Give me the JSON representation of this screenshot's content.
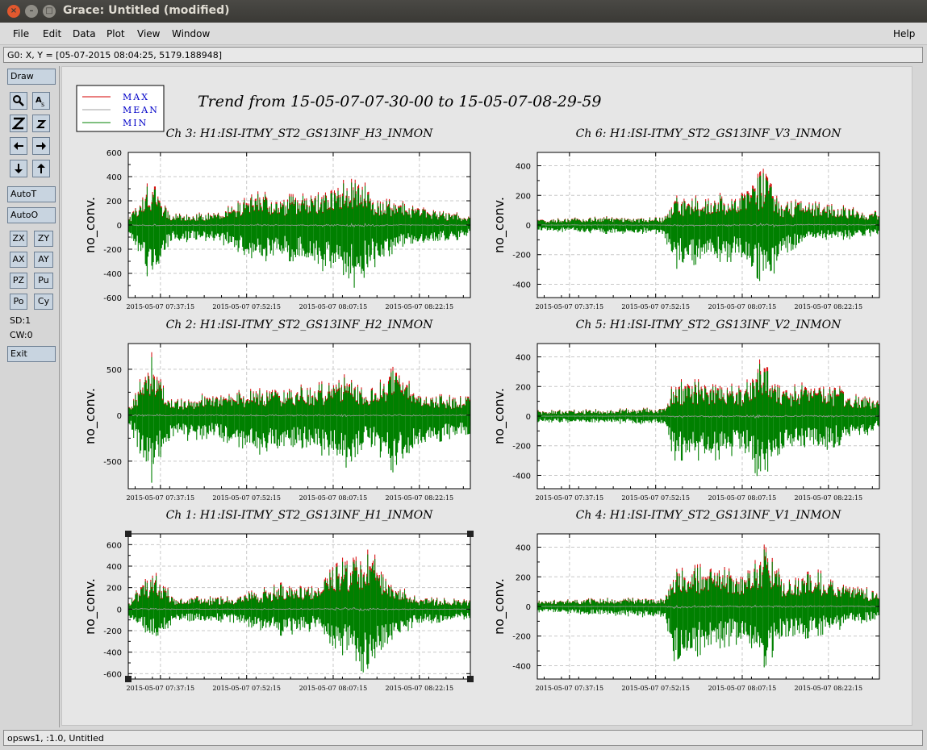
{
  "window": {
    "title": "Grace: Untitled (modified)",
    "close_glyph": "×",
    "min_glyph": "–",
    "max_glyph": "□"
  },
  "menu": {
    "items": [
      "File",
      "Edit",
      "Data",
      "Plot",
      "View",
      "Window"
    ],
    "help": "Help"
  },
  "locator": "G0: X, Y = [05-07-2015 08:04:25, 5179.188948]",
  "sidebar": {
    "draw": "Draw",
    "icon_buttons": [
      "zoom-icon",
      "autoscale-text-icon",
      "zoom-z-icon",
      "small-z-icon",
      "arrow-left-icon",
      "arrow-right-icon",
      "arrow-down-icon",
      "arrow-up-icon"
    ],
    "autot": "AutoT",
    "autoo": "AutoO",
    "pairs": [
      [
        "ZX",
        "ZY"
      ],
      [
        "AX",
        "AY"
      ],
      [
        "PZ",
        "Pu"
      ],
      [
        "Po",
        "Cy"
      ]
    ],
    "sd": "SD:1",
    "cw": "CW:0",
    "exit": "Exit"
  },
  "status": "opsws1, :1.0, Untitled",
  "legend": [
    {
      "label": "MAX",
      "color": "#d40000"
    },
    {
      "label": "MEAN",
      "color": "#a0a0a0"
    },
    {
      "label": "MIN",
      "color": "#008000"
    }
  ],
  "label_color": "#0000c8",
  "main_title": "Trend from 15-05-07-07-30-00 to 15-05-07-08-29-59",
  "chart_data": [
    {
      "type": "line",
      "title": "Ch 3: H1:ISI-ITMY_ST2_GS13INF_H3_INMON",
      "ylabel": "no_conv.",
      "ylim": [
        -600,
        600
      ],
      "yticks": [
        600,
        400,
        200,
        0,
        -200,
        -400,
        -600
      ],
      "xticks": [
        "2015-05-07 07:37:15",
        "2015-05-07 07:52:15",
        "2015-05-07 08:07:15",
        "2015-05-07 08:22:15"
      ],
      "envelope": [
        {
          "t": 0.0,
          "max": 60,
          "min": -60
        },
        {
          "t": 0.07,
          "max": 420,
          "min": -520
        },
        {
          "t": 0.12,
          "max": 110,
          "min": -150
        },
        {
          "t": 0.25,
          "max": 100,
          "min": -130
        },
        {
          "t": 0.38,
          "max": 280,
          "min": -300
        },
        {
          "t": 0.5,
          "max": 250,
          "min": -300
        },
        {
          "t": 0.6,
          "max": 360,
          "min": -420
        },
        {
          "t": 0.66,
          "max": 490,
          "min": -520
        },
        {
          "t": 0.72,
          "max": 230,
          "min": -350
        },
        {
          "t": 0.8,
          "max": 200,
          "min": -180
        },
        {
          "t": 0.92,
          "max": 130,
          "min": -150
        },
        {
          "t": 1.0,
          "max": 80,
          "min": -100
        }
      ]
    },
    {
      "type": "line",
      "title": "Ch 6: H1:ISI-ITMY_ST2_GS13INF_V3_INMON",
      "ylabel": "no_conv.",
      "ylim": [
        -490,
        490
      ],
      "yticks": [
        400,
        200,
        0,
        -200,
        -400
      ],
      "xticks": [
        "2015-05-07 07:37:15",
        "2015-05-07 07:52:15",
        "2015-05-07 08:07:15",
        "2015-05-07 08:22:15"
      ],
      "envelope": [
        {
          "t": 0.0,
          "max": 40,
          "min": -40
        },
        {
          "t": 0.2,
          "max": 60,
          "min": -60
        },
        {
          "t": 0.37,
          "max": 50,
          "min": -60
        },
        {
          "t": 0.4,
          "max": 200,
          "min": -300
        },
        {
          "t": 0.5,
          "max": 200,
          "min": -250
        },
        {
          "t": 0.6,
          "max": 250,
          "min": -250
        },
        {
          "t": 0.67,
          "max": 400,
          "min": -430
        },
        {
          "t": 0.72,
          "max": 150,
          "min": -200
        },
        {
          "t": 0.8,
          "max": 200,
          "min": -100
        },
        {
          "t": 0.9,
          "max": 130,
          "min": -100
        },
        {
          "t": 1.0,
          "max": 90,
          "min": -70
        }
      ]
    },
    {
      "type": "line",
      "title": "Ch 2: H1:ISI-ITMY_ST2_GS13INF_H2_INMON",
      "ylabel": "no_conv.",
      "ylim": [
        -800,
        780
      ],
      "yticks": [
        500,
        0,
        -500
      ],
      "xticks": [
        "2015-05-07 07:37:15",
        "2015-05-07 07:52:15",
        "2015-05-07 08:07:15",
        "2015-05-07 08:22:15"
      ],
      "envelope": [
        {
          "t": 0.0,
          "max": 100,
          "min": -100
        },
        {
          "t": 0.07,
          "max": 700,
          "min": -750
        },
        {
          "t": 0.12,
          "max": 200,
          "min": -300
        },
        {
          "t": 0.25,
          "max": 250,
          "min": -250
        },
        {
          "t": 0.4,
          "max": 300,
          "min": -450
        },
        {
          "t": 0.55,
          "max": 350,
          "min": -400
        },
        {
          "t": 0.63,
          "max": 450,
          "min": -600
        },
        {
          "t": 0.7,
          "max": 250,
          "min": -300
        },
        {
          "t": 0.78,
          "max": 550,
          "min": -650
        },
        {
          "t": 0.85,
          "max": 250,
          "min": -350
        },
        {
          "t": 1.0,
          "max": 200,
          "min": -200
        }
      ]
    },
    {
      "type": "line",
      "title": "Ch 5: H1:ISI-ITMY_ST2_GS13INF_V2_INMON",
      "ylabel": "no_conv.",
      "ylim": [
        -490,
        490
      ],
      "yticks": [
        400,
        200,
        0,
        -200,
        -400
      ],
      "xticks": [
        "2015-05-07 07:37:15",
        "2015-05-07 07:52:15",
        "2015-05-07 08:07:15",
        "2015-05-07 08:22:15"
      ],
      "envelope": [
        {
          "t": 0.0,
          "max": 40,
          "min": -40
        },
        {
          "t": 0.2,
          "max": 50,
          "min": -50
        },
        {
          "t": 0.37,
          "max": 60,
          "min": -60
        },
        {
          "t": 0.4,
          "max": 250,
          "min": -300
        },
        {
          "t": 0.52,
          "max": 250,
          "min": -300
        },
        {
          "t": 0.6,
          "max": 200,
          "min": -250
        },
        {
          "t": 0.66,
          "max": 420,
          "min": -470
        },
        {
          "t": 0.72,
          "max": 200,
          "min": -250
        },
        {
          "t": 0.82,
          "max": 250,
          "min": -250
        },
        {
          "t": 1.0,
          "max": 120,
          "min": -100
        }
      ]
    },
    {
      "type": "line",
      "title": "Ch 1: H1:ISI-ITMY_ST2_GS13INF_H1_INMON",
      "ylabel": "no_conv.",
      "ylim": [
        -650,
        700
      ],
      "yticks": [
        600,
        400,
        200,
        0,
        -200,
        -400,
        -600
      ],
      "xticks": [
        "2015-05-07 07:37:15",
        "2015-05-07 07:52:15",
        "2015-05-07 08:07:15",
        "2015-05-07 08:22:15"
      ],
      "envelope": [
        {
          "t": 0.0,
          "max": 80,
          "min": -80
        },
        {
          "t": 0.08,
          "max": 400,
          "min": -300
        },
        {
          "t": 0.13,
          "max": 120,
          "min": -130
        },
        {
          "t": 0.3,
          "max": 120,
          "min": -120
        },
        {
          "t": 0.45,
          "max": 250,
          "min": -250
        },
        {
          "t": 0.55,
          "max": 250,
          "min": -200
        },
        {
          "t": 0.65,
          "max": 550,
          "min": -500
        },
        {
          "t": 0.7,
          "max": 620,
          "min": -620
        },
        {
          "t": 0.76,
          "max": 300,
          "min": -350
        },
        {
          "t": 0.84,
          "max": 120,
          "min": -150
        },
        {
          "t": 1.0,
          "max": 90,
          "min": -90
        }
      ]
    },
    {
      "type": "line",
      "title": "Ch 4: H1:ISI-ITMY_ST2_GS13INF_V1_INMON",
      "ylabel": "no_conv.",
      "ylim": [
        -490,
        490
      ],
      "yticks": [
        400,
        200,
        0,
        -200,
        -400
      ],
      "xticks": [
        "2015-05-07 07:37:15",
        "2015-05-07 07:52:15",
        "2015-05-07 08:07:15",
        "2015-05-07 08:22:15"
      ],
      "envelope": [
        {
          "t": 0.0,
          "max": 40,
          "min": -40
        },
        {
          "t": 0.2,
          "max": 60,
          "min": -60
        },
        {
          "t": 0.37,
          "max": 60,
          "min": -80
        },
        {
          "t": 0.4,
          "max": 250,
          "min": -420
        },
        {
          "t": 0.5,
          "max": 300,
          "min": -300
        },
        {
          "t": 0.6,
          "max": 230,
          "min": -250
        },
        {
          "t": 0.66,
          "max": 430,
          "min": -420
        },
        {
          "t": 0.72,
          "max": 200,
          "min": -250
        },
        {
          "t": 0.82,
          "max": 250,
          "min": -200
        },
        {
          "t": 1.0,
          "max": 100,
          "min": -80
        }
      ]
    }
  ]
}
